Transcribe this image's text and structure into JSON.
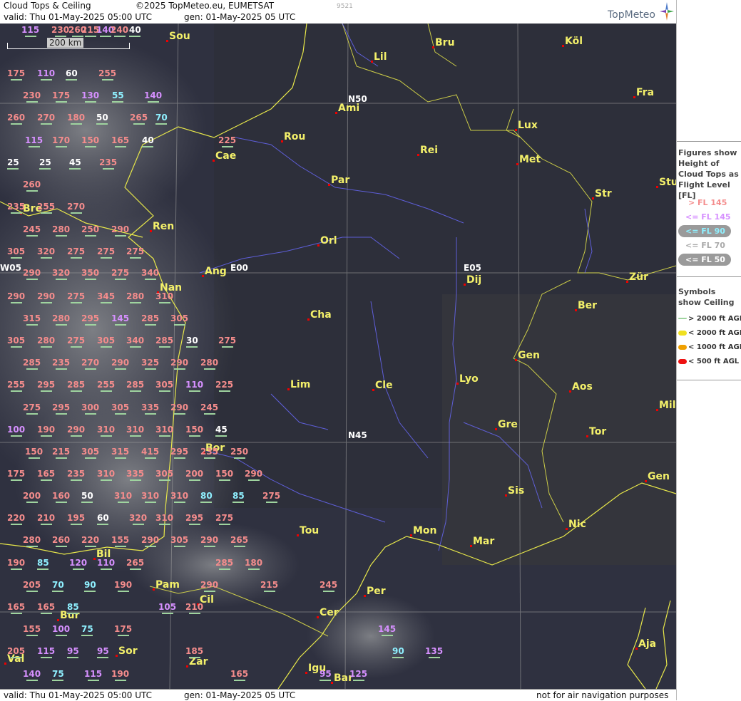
{
  "header": {
    "title": "Cloud Tops & Ceiling",
    "copyright": "©2025 TopMeteo.eu, EUMETSAT",
    "valid": "valid:  Thu  01-May-2025  05:00 UTC",
    "gen": "gen: 01-May-2025 05 UTC",
    "code": "9521",
    "logo": "TopMeteo"
  },
  "footer": {
    "valid": "valid:  Thu  01-May-2025  05:00 UTC",
    "gen": "gen: 01-May-2025 05 UTC",
    "disclaimer": "not for air navigation purposes"
  },
  "scale": "200 km",
  "colors": {
    "coast": "#e8e84a",
    "rivers": "#6a6aff",
    "grid": "#9a9a9a",
    "city": "#f3f06a"
  },
  "grid_labels": [
    "N50",
    "N45",
    "E00",
    "E05",
    "W05"
  ],
  "cities": [
    "Sou",
    "Köl",
    "Lil",
    "Bru",
    "Ami",
    "Fra",
    "Lux",
    "Rou",
    "Cae",
    "Rei",
    "Met",
    "Par",
    "Stu",
    "Str",
    "Bre",
    "Ren",
    "Orl",
    "Ang",
    "Dij",
    "Nan",
    "Zür",
    "Ber",
    "Cha",
    "Gen",
    "Lim",
    "Cle",
    "Lyo",
    "Aos",
    "Mil",
    "Gre",
    "Tor",
    "Bor",
    "Gen",
    "Sis",
    "Nic",
    "Tou",
    "Mon",
    "Mar",
    "Bil",
    "Pam",
    "Cil",
    "Per",
    "Bur",
    "Cer",
    "Sor",
    "Ajа",
    "Val",
    "Zar",
    "Igu",
    "Bar"
  ],
  "values": [
    [
      "260",
      "red"
    ],
    [
      "140",
      "mag"
    ],
    [
      "40",
      "white"
    ],
    [
      "115",
      "mag"
    ],
    [
      "230",
      "red"
    ],
    [
      "215",
      "red"
    ],
    [
      "240",
      "red"
    ],
    [
      "175",
      "red"
    ],
    [
      "110",
      "mag"
    ],
    [
      "60",
      "white"
    ],
    [
      "255",
      "red"
    ],
    [
      "230",
      "red"
    ],
    [
      "175",
      "red"
    ],
    [
      "130",
      "mag"
    ],
    [
      "55",
      "cyan"
    ],
    [
      "140",
      "mag"
    ],
    [
      "260",
      "red"
    ],
    [
      "270",
      "red"
    ],
    [
      "180",
      "red"
    ],
    [
      "50",
      "white"
    ],
    [
      "265",
      "red"
    ],
    [
      "70",
      "cyan"
    ],
    [
      "115",
      "mag"
    ],
    [
      "170",
      "red"
    ],
    [
      "150",
      "red"
    ],
    [
      "165",
      "red"
    ],
    [
      "40",
      "white"
    ],
    [
      "225",
      "red"
    ],
    [
      "25",
      "white"
    ],
    [
      "25",
      "white"
    ],
    [
      "45",
      "white"
    ],
    [
      "235",
      "red"
    ],
    [
      "260",
      "red"
    ],
    [
      "235",
      "red"
    ],
    [
      "255",
      "red"
    ],
    [
      "270",
      "red"
    ],
    [
      "245",
      "red"
    ],
    [
      "280",
      "red"
    ],
    [
      "250",
      "red"
    ],
    [
      "290",
      "red"
    ],
    [
      "305",
      "red"
    ],
    [
      "320",
      "red"
    ],
    [
      "275",
      "red"
    ],
    [
      "275",
      "red"
    ],
    [
      "275",
      "red"
    ],
    [
      "290",
      "red"
    ],
    [
      "320",
      "red"
    ],
    [
      "350",
      "red"
    ],
    [
      "275",
      "red"
    ],
    [
      "340",
      "red"
    ],
    [
      "290",
      "red"
    ],
    [
      "290",
      "red"
    ],
    [
      "275",
      "red"
    ],
    [
      "345",
      "red"
    ],
    [
      "280",
      "red"
    ],
    [
      "310",
      "red"
    ],
    [
      "315",
      "red"
    ],
    [
      "280",
      "red"
    ],
    [
      "295",
      "red"
    ],
    [
      "145",
      "mag"
    ],
    [
      "285",
      "red"
    ],
    [
      "305",
      "red"
    ],
    [
      "305",
      "red"
    ],
    [
      "280",
      "red"
    ],
    [
      "275",
      "red"
    ],
    [
      "305",
      "red"
    ],
    [
      "340",
      "red"
    ],
    [
      "285",
      "red"
    ],
    [
      "30",
      "white"
    ],
    [
      "275",
      "red"
    ],
    [
      "285",
      "red"
    ],
    [
      "235",
      "red"
    ],
    [
      "270",
      "red"
    ],
    [
      "290",
      "red"
    ],
    [
      "325",
      "red"
    ],
    [
      "290",
      "red"
    ],
    [
      "280",
      "red"
    ],
    [
      "255",
      "red"
    ],
    [
      "295",
      "red"
    ],
    [
      "285",
      "red"
    ],
    [
      "255",
      "red"
    ],
    [
      "285",
      "red"
    ],
    [
      "305",
      "red"
    ],
    [
      "110",
      "mag"
    ],
    [
      "225",
      "red"
    ],
    [
      "275",
      "red"
    ],
    [
      "295",
      "red"
    ],
    [
      "300",
      "red"
    ],
    [
      "305",
      "red"
    ],
    [
      "335",
      "red"
    ],
    [
      "290",
      "red"
    ],
    [
      "245",
      "red"
    ],
    [
      "100",
      "mag"
    ],
    [
      "190",
      "red"
    ],
    [
      "290",
      "red"
    ],
    [
      "310",
      "red"
    ],
    [
      "310",
      "red"
    ],
    [
      "310",
      "red"
    ],
    [
      "150",
      "red"
    ],
    [
      "45",
      "white"
    ],
    [
      "150",
      "red"
    ],
    [
      "215",
      "red"
    ],
    [
      "305",
      "red"
    ],
    [
      "315",
      "red"
    ],
    [
      "415",
      "red"
    ],
    [
      "295",
      "red"
    ],
    [
      "235",
      "red"
    ],
    [
      "250",
      "red"
    ],
    [
      "175",
      "red"
    ],
    [
      "165",
      "red"
    ],
    [
      "235",
      "red"
    ],
    [
      "310",
      "red"
    ],
    [
      "335",
      "red"
    ],
    [
      "305",
      "red"
    ],
    [
      "200",
      "red"
    ],
    [
      "150",
      "red"
    ],
    [
      "290",
      "red"
    ],
    [
      "200",
      "red"
    ],
    [
      "160",
      "red"
    ],
    [
      "50",
      "white"
    ],
    [
      "310",
      "red"
    ],
    [
      "310",
      "red"
    ],
    [
      "310",
      "red"
    ],
    [
      "80",
      "cyan"
    ],
    [
      "85",
      "cyan"
    ],
    [
      "275",
      "red"
    ],
    [
      "220",
      "red"
    ],
    [
      "210",
      "red"
    ],
    [
      "195",
      "red"
    ],
    [
      "60",
      "white"
    ],
    [
      "320",
      "red"
    ],
    [
      "310",
      "red"
    ],
    [
      "295",
      "red"
    ],
    [
      "275",
      "red"
    ],
    [
      "280",
      "red"
    ],
    [
      "260",
      "red"
    ],
    [
      "220",
      "red"
    ],
    [
      "155",
      "red"
    ],
    [
      "290",
      "red"
    ],
    [
      "305",
      "red"
    ],
    [
      "290",
      "red"
    ],
    [
      "265",
      "red"
    ],
    [
      "190",
      "red"
    ],
    [
      "85",
      "cyan"
    ],
    [
      "120",
      "mag"
    ],
    [
      "110",
      "mag"
    ],
    [
      "265",
      "red"
    ],
    [
      "285",
      "red"
    ],
    [
      "180",
      "red"
    ],
    [
      "205",
      "red"
    ],
    [
      "70",
      "cyan"
    ],
    [
      "90",
      "cyan"
    ],
    [
      "190",
      "red"
    ],
    [
      "290",
      "red"
    ],
    [
      "215",
      "red"
    ],
    [
      "245",
      "red"
    ],
    [
      "165",
      "red"
    ],
    [
      "165",
      "red"
    ],
    [
      "85",
      "cyan"
    ],
    [
      "105",
      "mag"
    ],
    [
      "210",
      "red"
    ],
    [
      "155",
      "red"
    ],
    [
      "100",
      "mag"
    ],
    [
      "75",
      "cyan"
    ],
    [
      "175",
      "red"
    ],
    [
      "145",
      "mag"
    ],
    [
      "205",
      "red"
    ],
    [
      "115",
      "mag"
    ],
    [
      "95",
      "mag"
    ],
    [
      "95",
      "mag"
    ],
    [
      "185",
      "red"
    ],
    [
      "90",
      "cyan"
    ],
    [
      "135",
      "mag"
    ],
    [
      "140",
      "mag"
    ],
    [
      "75",
      "cyan"
    ],
    [
      "115",
      "mag"
    ],
    [
      "190",
      "red"
    ],
    [
      "165",
      "red"
    ],
    [
      "95",
      "mag"
    ],
    [
      "125",
      "mag"
    ]
  ],
  "legend": {
    "figures_title": "Figures show Height of Cloud Tops as Flight Level  [FL]",
    "levels": [
      {
        "label": "> FL 145",
        "color": "#f48c8c"
      },
      {
        "label": "<= FL 145",
        "color": "#d690ff"
      },
      {
        "label": "<= FL 90",
        "color": "#8ff0ff"
      },
      {
        "label": "<= FL 70",
        "color": "#aaaaaa"
      },
      {
        "label": "<= FL 50",
        "color": "#ffffff"
      }
    ],
    "symbols_title": "Symbols show Ceiling",
    "symbols": [
      {
        "label": "> 2000 ft AGL",
        "color": "#9fd49f"
      },
      {
        "label": "< 2000 ft AGL",
        "color": "#f0e020"
      },
      {
        "label": "< 1000 ft AGL",
        "color": "#f0a000"
      },
      {
        "label": "< 500 ft AGL",
        "color": "#ee1111"
      }
    ]
  }
}
